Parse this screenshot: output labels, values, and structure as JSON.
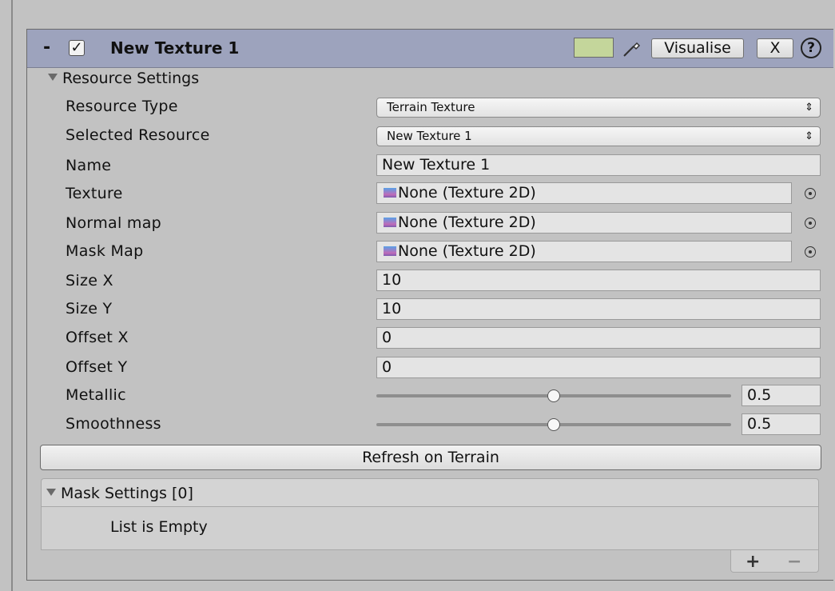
{
  "header": {
    "collapse_label": "-",
    "enabled_check": "✓",
    "title": "New Texture 1",
    "color_swatch": "#c4d69b",
    "visualise_label": "Visualise",
    "close_label": "X",
    "help_label": "?"
  },
  "resource_settings": {
    "foldout_label": "Resource Settings",
    "fields": {
      "resource_type": {
        "label": "Resource Type",
        "value": "Terrain Texture"
      },
      "selected_resource": {
        "label": "Selected Resource",
        "value": "New Texture 1"
      },
      "name": {
        "label": "Name",
        "value": "New Texture 1"
      },
      "texture": {
        "label": "Texture",
        "value": "None (Texture 2D)"
      },
      "normal_map": {
        "label": "Normal map",
        "value": "None (Texture 2D)"
      },
      "mask_map": {
        "label": "Mask Map",
        "value": "None (Texture 2D)"
      },
      "size_x": {
        "label": "Size X",
        "value": "10"
      },
      "size_y": {
        "label": "Size Y",
        "value": "10"
      },
      "offset_x": {
        "label": "Offset X",
        "value": "0"
      },
      "offset_y": {
        "label": "Offset Y",
        "value": "0"
      },
      "metallic": {
        "label": "Metallic",
        "value": "0.5",
        "fraction": 0.5
      },
      "smoothness": {
        "label": "Smoothness",
        "value": "0.5",
        "fraction": 0.5
      }
    },
    "popup_arrows": "⇕"
  },
  "refresh_button": "Refresh on Terrain",
  "mask_settings": {
    "foldout_label": "Mask Settings [0]",
    "empty_text": "List is Empty",
    "add_label": "+",
    "remove_label": "−"
  }
}
